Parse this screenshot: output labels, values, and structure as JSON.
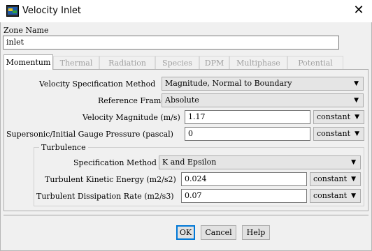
{
  "window": {
    "title": "Velocity Inlet",
    "close_glyph": "✕"
  },
  "zone": {
    "label": "Zone Name",
    "value": "inlet"
  },
  "tabs": [
    {
      "label": "Momentum",
      "active": true
    },
    {
      "label": "Thermal",
      "active": false
    },
    {
      "label": "Radiation",
      "active": false
    },
    {
      "label": "Species",
      "active": false
    },
    {
      "label": "DPM",
      "active": false
    },
    {
      "label": "Multiphase",
      "active": false
    },
    {
      "label": "Potential",
      "active": false
    }
  ],
  "momentum": {
    "velocity_spec": {
      "label": "Velocity Specification Method",
      "value": "Magnitude, Normal to Boundary"
    },
    "reference_frame": {
      "label": "Reference Frame",
      "value": "Absolute"
    },
    "velocity_magnitude": {
      "label": "Velocity Magnitude (m/s)",
      "value": "1.17",
      "method": "constant"
    },
    "gauge_pressure": {
      "label": "Supersonic/Initial Gauge Pressure (pascal)",
      "value": "0",
      "method": "constant"
    },
    "turbulence": {
      "title": "Turbulence",
      "spec_method": {
        "label": "Specification Method",
        "value": "K and Epsilon"
      },
      "kinetic_energy": {
        "label": "Turbulent Kinetic Energy (m2/s2)",
        "value": "0.024",
        "method": "constant"
      },
      "dissipation_rate": {
        "label": "Turbulent Dissipation Rate (m2/s3)",
        "value": "0.07",
        "method": "constant"
      }
    }
  },
  "buttons": {
    "ok": "OK",
    "cancel": "Cancel",
    "help": "Help"
  },
  "icons": {
    "dropdown": "▼"
  },
  "colors": {
    "focus_border": "#0078d7",
    "tab_inactive_text": "#a0a0a0"
  }
}
